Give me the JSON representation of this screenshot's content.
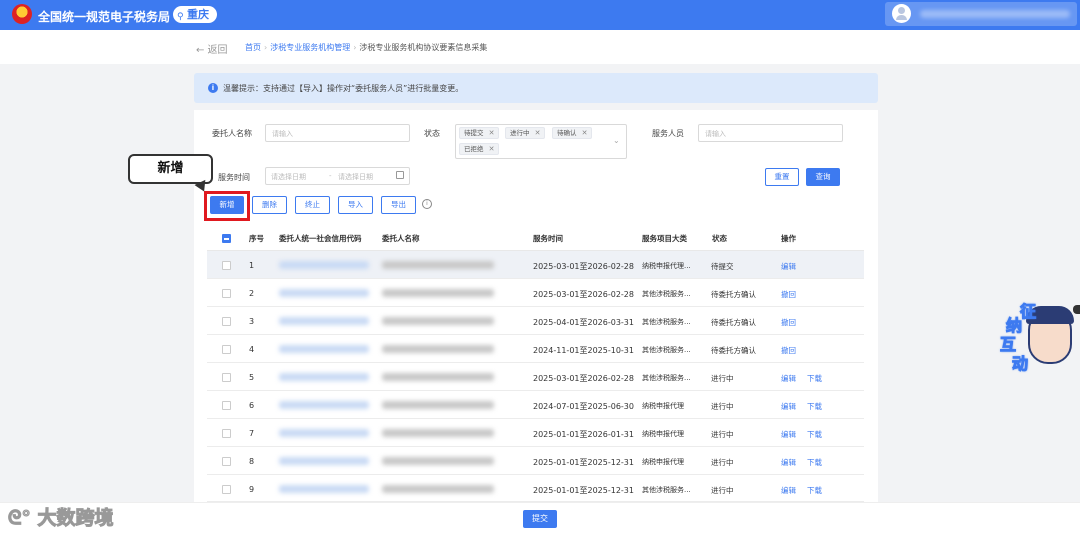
{
  "header": {
    "brand": "全国统一规范电子税务局",
    "city": "重庆",
    "city_icon": "location-pin-icon",
    "brand_colors": {
      "primary": "#3d7af0",
      "emblem": "#d22222"
    }
  },
  "breadcrumb": {
    "back": "← 返回",
    "items": [
      "首页",
      "涉税专业服务机构管理",
      "涉税专业服务机构协议要素信息采集"
    ]
  },
  "banner": {
    "text": "温馨提示：支持通过【导入】操作对“委托服务人员”进行批量变更。"
  },
  "filters": {
    "client_name_label": "委托人名称",
    "client_name_placeholder": "请输入",
    "status_label": "状态",
    "status_tags": [
      "待提交",
      "进行中",
      "待确认",
      "已拒绝"
    ],
    "staff_label": "服务人员",
    "staff_placeholder": "请输入",
    "time_label": "服务时间",
    "start_placeholder": "请选择日期",
    "range_sep": "-",
    "end_placeholder": "请选择日期",
    "reset": "重置",
    "query": "查询"
  },
  "toolbar": {
    "add": "新增",
    "delete": "删除",
    "terminate": "终止",
    "import": "导入",
    "export": "导出"
  },
  "callout": {
    "text": "新增"
  },
  "table": {
    "headers": [
      "序号",
      "委托人统一社会信用代码",
      "委托人名称",
      "服务时间",
      "服务项目大类",
      "状态",
      "操作"
    ],
    "rows": [
      {
        "no": "1",
        "time": "2025-03-01至2026-02-28",
        "category": "纳税申报代理...",
        "status": "待提交",
        "ops": [
          "编辑"
        ]
      },
      {
        "no": "2",
        "time": "2025-03-01至2026-02-28",
        "category": "其他涉税服务...",
        "status": "待委托方确认",
        "ops": [
          "撤回"
        ]
      },
      {
        "no": "3",
        "time": "2025-04-01至2026-03-31",
        "category": "其他涉税服务...",
        "status": "待委托方确认",
        "ops": [
          "撤回"
        ]
      },
      {
        "no": "4",
        "time": "2024-11-01至2025-10-31",
        "category": "其他涉税服务...",
        "status": "待委托方确认",
        "ops": [
          "撤回"
        ]
      },
      {
        "no": "5",
        "time": "2025-03-01至2026-02-28",
        "category": "其他涉税服务...",
        "status": "进行中",
        "ops": [
          "编辑",
          "下载"
        ]
      },
      {
        "no": "6",
        "time": "2024-07-01至2025-06-30",
        "category": "纳税申报代理",
        "status": "进行中",
        "ops": [
          "编辑",
          "下载"
        ]
      },
      {
        "no": "7",
        "time": "2025-01-01至2026-01-31",
        "category": "纳税申报代理",
        "status": "进行中",
        "ops": [
          "编辑",
          "下载"
        ]
      },
      {
        "no": "8",
        "time": "2025-01-01至2025-12-31",
        "category": "纳税申报代理",
        "status": "进行中",
        "ops": [
          "编辑",
          "下载"
        ]
      },
      {
        "no": "9",
        "time": "2025-01-01至2025-12-31",
        "category": "其他涉税服务...",
        "status": "进行中",
        "ops": [
          "编辑",
          "下载"
        ]
      }
    ]
  },
  "mascot": {
    "chars": [
      "征",
      "纳",
      "互",
      "动"
    ]
  },
  "footer": {
    "submit": "提交",
    "watermark": "大数跨境"
  }
}
